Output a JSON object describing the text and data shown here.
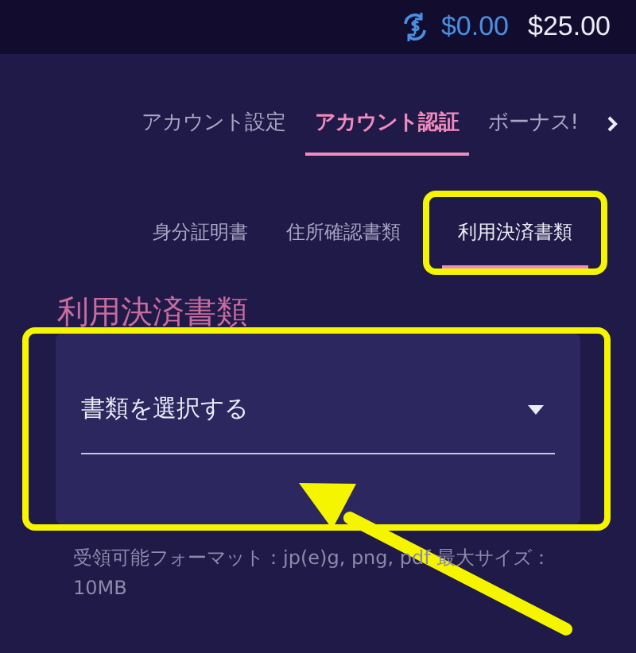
{
  "balances": [
    {
      "amount": "$0.00",
      "kind": "bonus"
    },
    {
      "amount": "$25.00",
      "kind": "cash"
    }
  ],
  "tabs": [
    {
      "label": "アカウント設定",
      "selected": false
    },
    {
      "label": "アカウント認証",
      "selected": true
    },
    {
      "label": "ボーナス!",
      "selected": false
    }
  ],
  "subtabs": [
    {
      "label": "身分証明書",
      "selected": false,
      "highlighted": false
    },
    {
      "label": "住所確認書類",
      "selected": false,
      "highlighted": false
    },
    {
      "label": "利用決済書類",
      "selected": true,
      "highlighted": true
    }
  ],
  "section_title": "利用決済書類",
  "document_select": {
    "placeholder": "書類を選択する",
    "highlighted": true
  },
  "format_note": "受領可能フォーマット：jp(e)g, png, pdf 最大サイズ：10MB",
  "annotation_arrow": true
}
